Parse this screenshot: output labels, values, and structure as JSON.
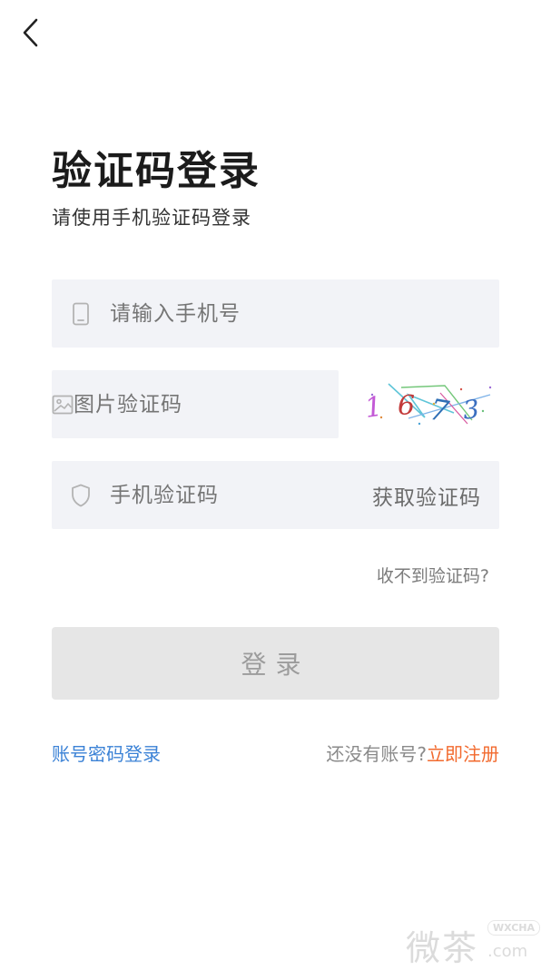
{
  "header": {
    "back_icon": "chevron-left-icon"
  },
  "page": {
    "title": "验证码登录",
    "subtitle": "请使用手机验证码登录"
  },
  "form": {
    "phone": {
      "placeholder": "请输入手机号",
      "icon": "phone-icon"
    },
    "image_code": {
      "placeholder": "图片验证码",
      "icon": "image-icon",
      "captcha_text": "1673"
    },
    "sms_code": {
      "placeholder": "手机验证码",
      "icon": "shield-icon",
      "get_code_label": "获取验证码"
    },
    "no_code_link": "收不到验证码?",
    "login_label": "登录"
  },
  "footer": {
    "password_login": "账号密码登录",
    "no_account": "还没有账号?",
    "register": "立即注册"
  },
  "watermark": {
    "cn": "微茶",
    "badge": "WXCHA",
    "domain": ".com"
  },
  "colors": {
    "link_blue": "#3b82d6",
    "register_orange": "#f26a2e",
    "field_bg": "#f2f3f7",
    "button_bg": "#e6e6e6"
  }
}
